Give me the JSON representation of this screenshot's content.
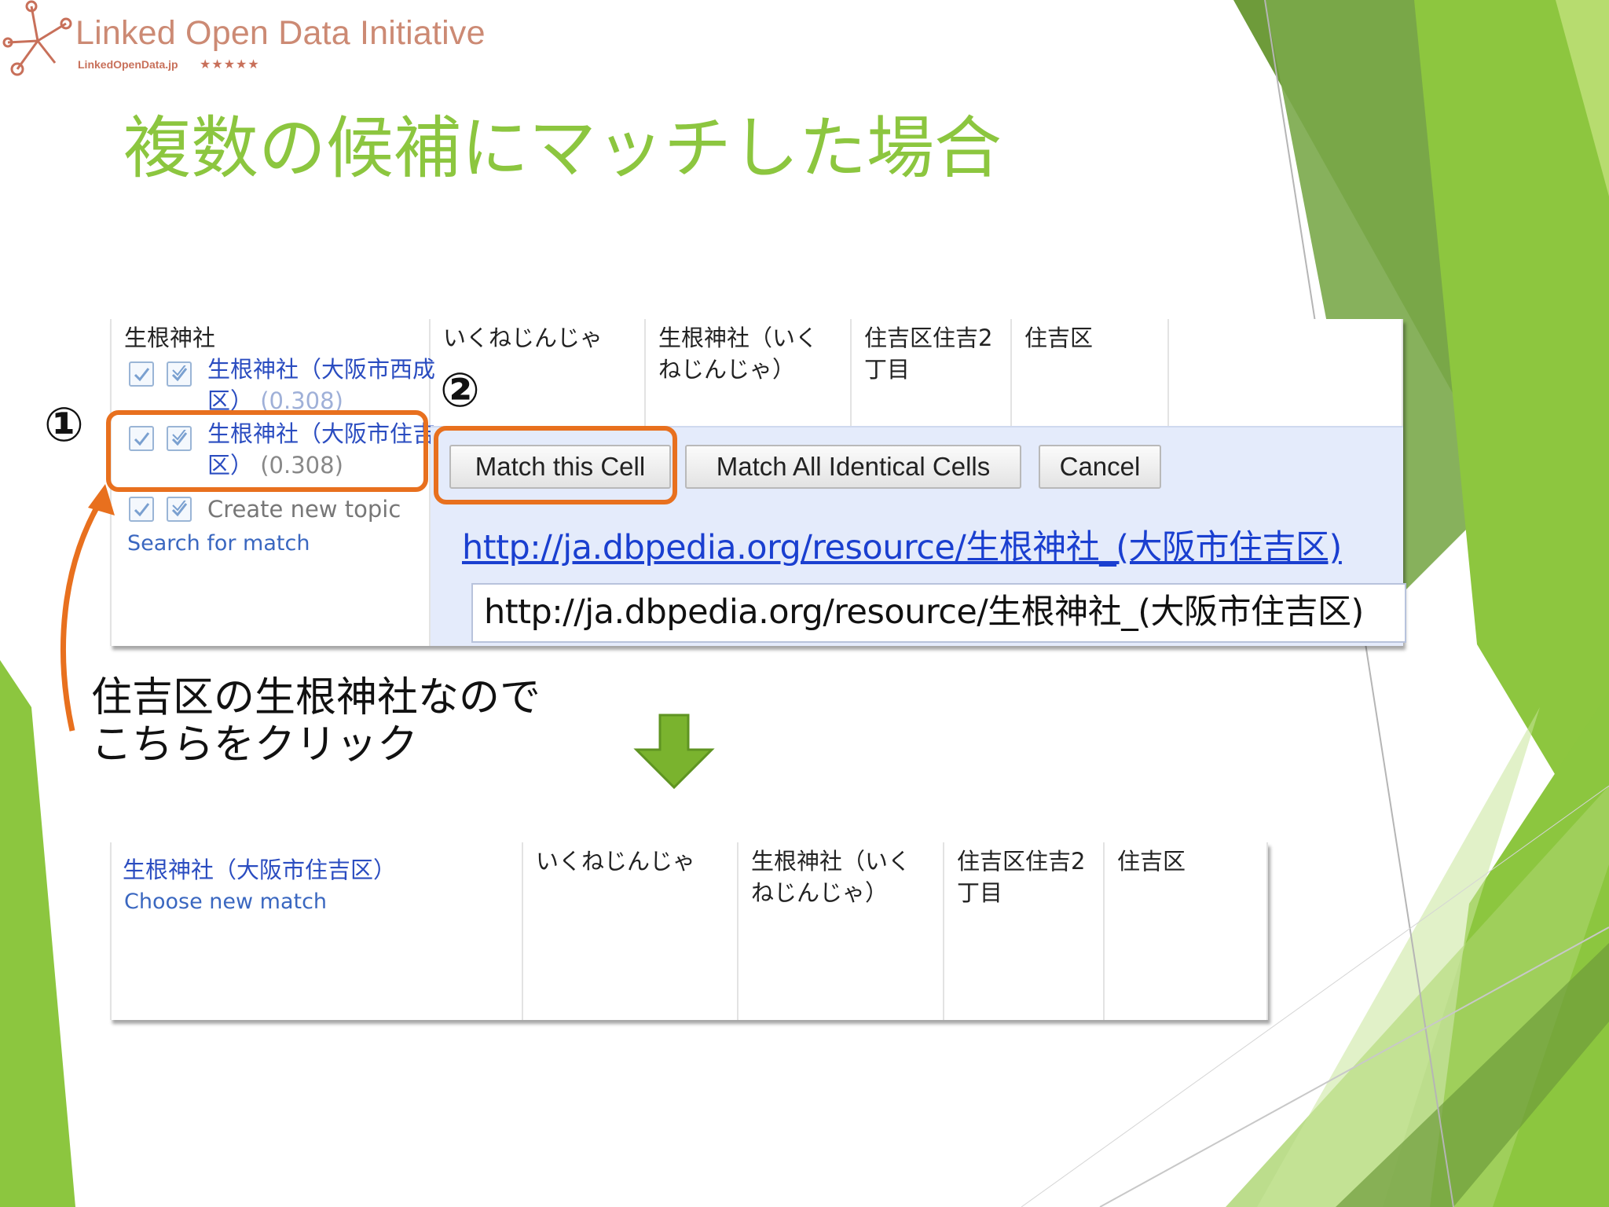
{
  "logo": {
    "title": "Linked Open Data Initiative",
    "subtitle": "LinkedOpenData.jp",
    "stars": "★★★★★"
  },
  "slide": {
    "title": "複数の候補にマッチした場合",
    "caption": "住吉区の生根神社なので\nこちらをクリック",
    "step1": "①",
    "step2": "②"
  },
  "colors": {
    "title_green": "#8cc63f",
    "highlight_orange": "#e8701e",
    "arrow_green": "#7ab32e",
    "link_blue": "#2a4cc0"
  },
  "table_before": {
    "cell_value": "生根神社",
    "candidates": [
      {
        "label": "生根神社（大阪市西成区）",
        "score": "(0.308)"
      },
      {
        "label": "生根神社（大阪市住吉区）",
        "score": "(0.308)"
      },
      {
        "label": "Create new topic",
        "score": ""
      }
    ],
    "search_link": "Search for match",
    "other_cells": [
      "いくねじんじゃ",
      "生根神社（いくねじんじゃ）",
      "住吉区住吉2丁目",
      "住吉区"
    ],
    "actions": {
      "match_this": "Match this Cell",
      "match_all": "Match All Identical Cells",
      "cancel": "Cancel"
    },
    "uri_link": "http://ja.dbpedia.org/resource/生根神社_(大阪市住吉区)",
    "uri_input": "http://ja.dbpedia.org/resource/生根神社_(大阪市住吉区)"
  },
  "table_after": {
    "matched": "生根神社（大阪市住吉区）",
    "choose_new": "Choose new match",
    "other_cells": [
      "いくねじんじゃ",
      "生根神社（いくねじんじゃ）",
      "住吉区住吉2丁目",
      "住吉区"
    ]
  }
}
